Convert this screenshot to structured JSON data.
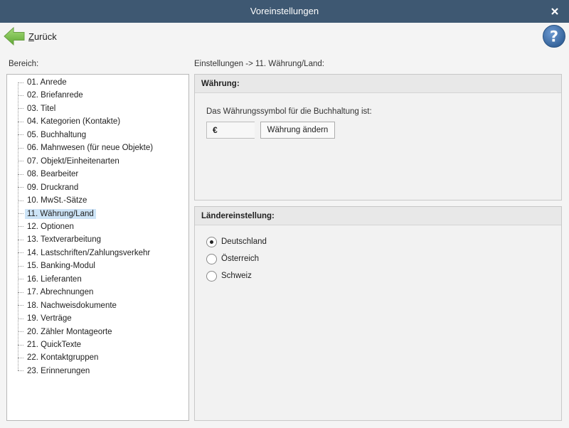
{
  "window": {
    "title": "Voreinstellungen"
  },
  "toolbar": {
    "back_label_first": "Z",
    "back_label_rest": "urück"
  },
  "sidebar": {
    "label": "Bereich:",
    "items": [
      {
        "label": "01. Anrede"
      },
      {
        "label": "02. Briefanrede"
      },
      {
        "label": "03. Titel"
      },
      {
        "label": "04. Kategorien (Kontakte)"
      },
      {
        "label": "05. Buchhaltung"
      },
      {
        "label": "06. Mahnwesen (für neue Objekte)"
      },
      {
        "label": "07. Objekt/Einheitenarten"
      },
      {
        "label": "08. Bearbeiter"
      },
      {
        "label": "09. Druckrand"
      },
      {
        "label": "10. MwSt.-Sätze"
      },
      {
        "label": "11. Währung/Land",
        "selected": true
      },
      {
        "label": "12. Optionen"
      },
      {
        "label": "13. Textverarbeitung"
      },
      {
        "label": "14. Lastschriften/Zahlungsverkehr"
      },
      {
        "label": "15. Banking-Modul"
      },
      {
        "label": "16. Lieferanten"
      },
      {
        "label": "17. Abrechnungen"
      },
      {
        "label": "18. Nachweisdokumente"
      },
      {
        "label": "19. Verträge"
      },
      {
        "label": "20. Zähler Montageorte"
      },
      {
        "label": "21. QuickTexte"
      },
      {
        "label": "22. Kontaktgruppen"
      },
      {
        "label": "23. Erinnerungen"
      }
    ]
  },
  "main": {
    "breadcrumb": "Einstellungen -> 11. Währung/Land:",
    "currency": {
      "heading": "Währung:",
      "description": "Das Währungssymbol für die Buchhaltung ist:",
      "symbol": "€",
      "change_button": "Währung ändern"
    },
    "country": {
      "heading": "Ländereinstellung:",
      "options": [
        {
          "label": "Deutschland",
          "checked": true
        },
        {
          "label": "Österreich",
          "checked": false
        },
        {
          "label": "Schweiz",
          "checked": false
        }
      ]
    }
  },
  "colors": {
    "titlebar": "#3e5872",
    "selection": "#cde4f7",
    "help_icon": "#3f6fa6",
    "back_arrow": "#7cc04a"
  },
  "icons": {
    "close": "close-icon",
    "back": "back-arrow-icon",
    "help": "help-icon"
  }
}
